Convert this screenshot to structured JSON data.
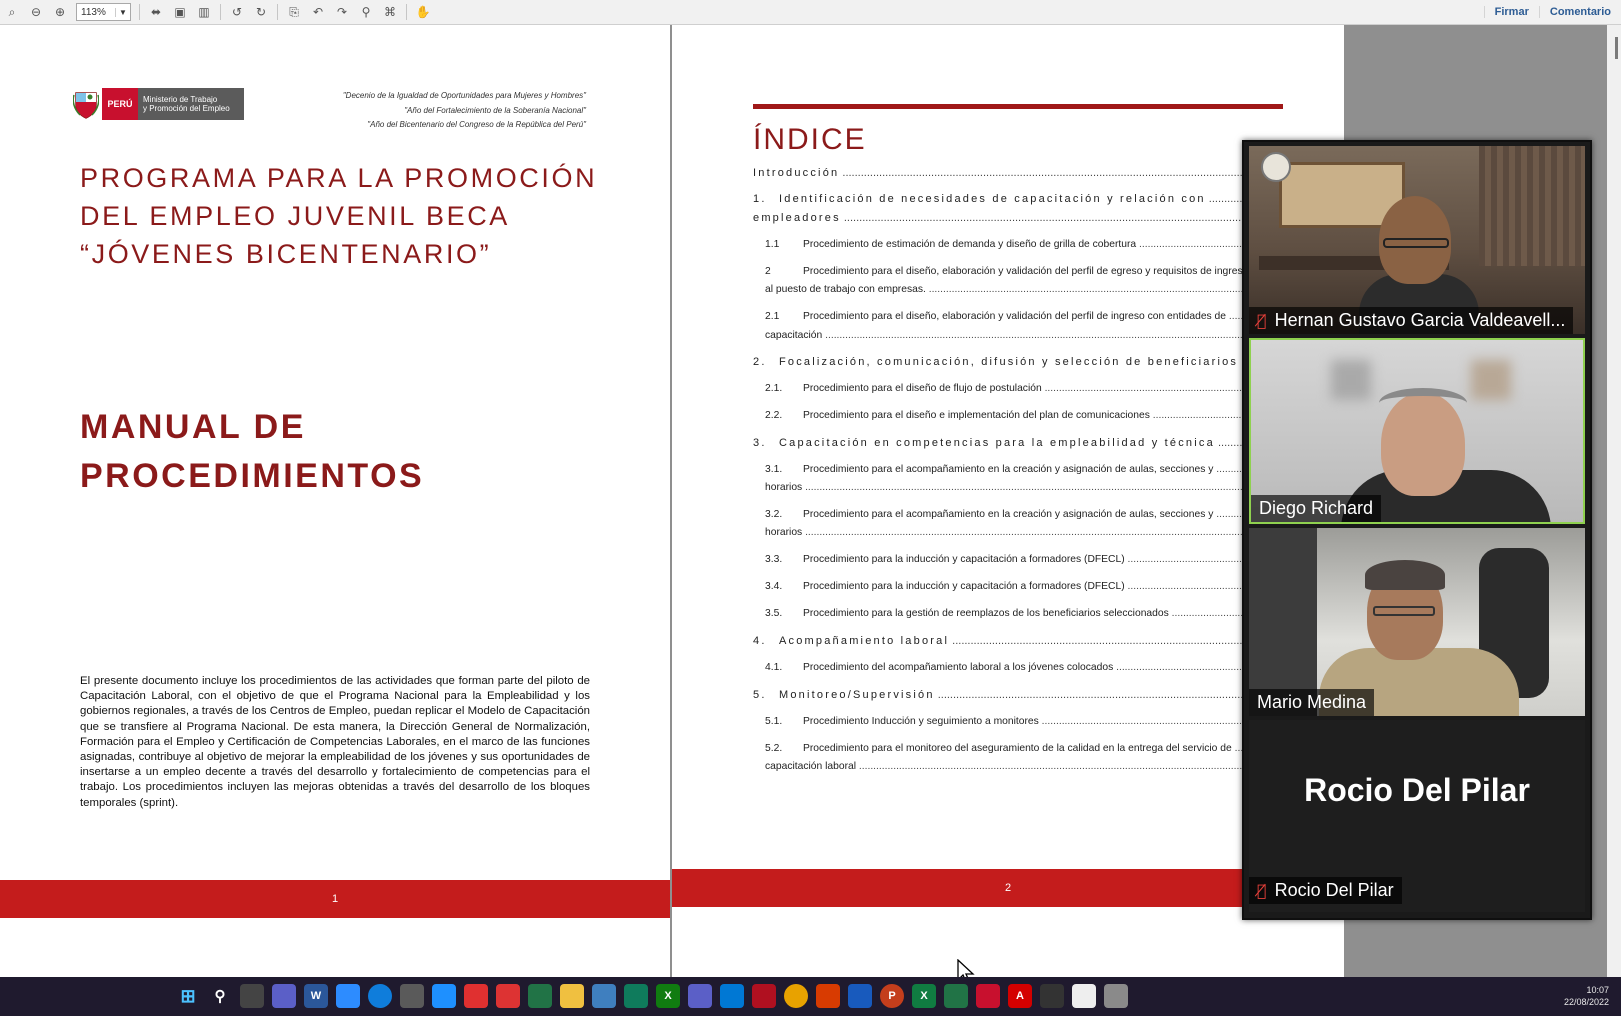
{
  "toolbar": {
    "zoom": "113%",
    "sign_label": "Firmar",
    "comment_label": "Comentario"
  },
  "page1": {
    "logo": {
      "peru": "PERÚ",
      "ministry_line1": "Ministerio de Trabajo",
      "ministry_line2": "y Promoción del Empleo"
    },
    "decree_lines": [
      "\"Decenio de la Igualdad de Oportunidades para Mujeres y Hombres\"",
      "\"Año del Fortalecimiento de la Soberanía Nacional\"",
      "\"Año del Bicentenario del Congreso de la República del Perú\""
    ],
    "program_title": "PROGRAMA PARA LA PROMOCIÓN DEL EMPLEO JUVENIL BECA “JÓVENES BICENTENARIO”",
    "manual_title_line1": "MANUAL DE",
    "manual_title_line2": "PROCEDIMIENTOS",
    "intro": "El presente documento incluye los procedimientos de las actividades que forman parte del piloto de Capacitación Laboral, con el objetivo de que el Programa Nacional para la Empleabilidad y los gobiernos regionales, a través de los Centros de Empleo, puedan replicar el Modelo de Capacitación que se transfiere al Programa Nacional. De esta manera, la Dirección General de Normalización, Formación para el Empleo y Certificación de Competencias Laborales, en el marco de las funciones asignadas, contribuye al objetivo de mejorar la empleabilidad de los jóvenes y sus oportunidades de insertarse a un empleo decente a través del desarrollo y fortalecimiento de competencias para el trabajo. Los procedimientos incluyen las mejoras obtenidas a través del desarrollo de los bloques temporales (sprint).",
    "page_number": "1"
  },
  "page2": {
    "index_title": "ÍNDICE",
    "toc": [
      {
        "num": "",
        "text": "Introducción",
        "level": "h"
      },
      {
        "num": "1.",
        "text": "Identificación de necesidades de capacitación y relación con",
        "level": "h"
      },
      {
        "num": "",
        "text": "empleadores",
        "level": "h"
      },
      {
        "num": "1.1",
        "text": "Procedimiento de estimación de demanda y diseño de grilla de cobertura",
        "level": "s"
      },
      {
        "num": "2",
        "text": "Procedimiento para el diseño, elaboración y validación del perfil de egreso y requisitos de ingreso",
        "level": "s"
      },
      {
        "num": "",
        "text": "al puesto de trabajo con empresas.",
        "level": "s"
      },
      {
        "num": "2.1",
        "text": "Procedimiento para el diseño, elaboración y validación del perfil de ingreso con entidades de",
        "level": "s"
      },
      {
        "num": "",
        "text": "capacitación",
        "level": "s"
      },
      {
        "num": "2.",
        "text": "Focalización, comunicación, difusión y selección de beneficiarios",
        "level": "h"
      },
      {
        "num": "2.1.",
        "text": "Procedimiento para el diseño de flujo de postulación",
        "level": "s"
      },
      {
        "num": "2.2.",
        "text": "Procedimiento para el diseño e implementación del plan de comunicaciones",
        "level": "s"
      },
      {
        "num": "3.",
        "text": "Capacitación en competencias para la empleabilidad y técnica",
        "level": "h"
      },
      {
        "num": "3.1.",
        "text": "Procedimiento para el acompañamiento en la creación y asignación de aulas, secciones y",
        "level": "s"
      },
      {
        "num": "",
        "text": "horarios",
        "level": "s"
      },
      {
        "num": "3.2.",
        "text": "Procedimiento para el acompañamiento en la creación y asignación de aulas, secciones y",
        "level": "s"
      },
      {
        "num": "",
        "text": "horarios",
        "level": "s"
      },
      {
        "num": "3.3.",
        "text": "Procedimiento para la inducción y capacitación a formadores (DFECL)",
        "level": "s"
      },
      {
        "num": "3.4.",
        "text": "Procedimiento para la inducción y capacitación a formadores (DFECL)",
        "level": "s"
      },
      {
        "num": "3.5.",
        "text": "Procedimiento para la gestión de reemplazos de los beneficiarios seleccionados",
        "level": "s"
      },
      {
        "num": "4.",
        "text": "Acompañamiento laboral",
        "level": "h"
      },
      {
        "num": "4.1.",
        "text": "Procedimiento del acompañamiento laboral a los jóvenes colocados",
        "level": "s"
      },
      {
        "num": "5.",
        "text": "Monitoreo/Supervisión",
        "level": "h"
      },
      {
        "num": "5.1.",
        "text": "Procedimiento Inducción y seguimiento a monitores",
        "level": "s"
      },
      {
        "num": "5.2.",
        "text": "Procedimiento para el monitoreo del aseguramiento de la calidad en la entrega del servicio de",
        "level": "s"
      },
      {
        "num": "",
        "text": "capacitación laboral",
        "level": "s"
      }
    ],
    "page_number": "2"
  },
  "video": {
    "participants": [
      {
        "name": "Hernan Gustavo Garcia Valdeavell...",
        "muted": true
      },
      {
        "name": "Diego Richard",
        "muted": false
      },
      {
        "name": "Mario Medina",
        "muted": false
      },
      {
        "name": "Rocio Del Pilar",
        "muted": true
      }
    ],
    "placeholder_name": "Rocio Del Pilar"
  },
  "taskbar": {
    "time": "10:07",
    "date": "22/08/2022"
  }
}
